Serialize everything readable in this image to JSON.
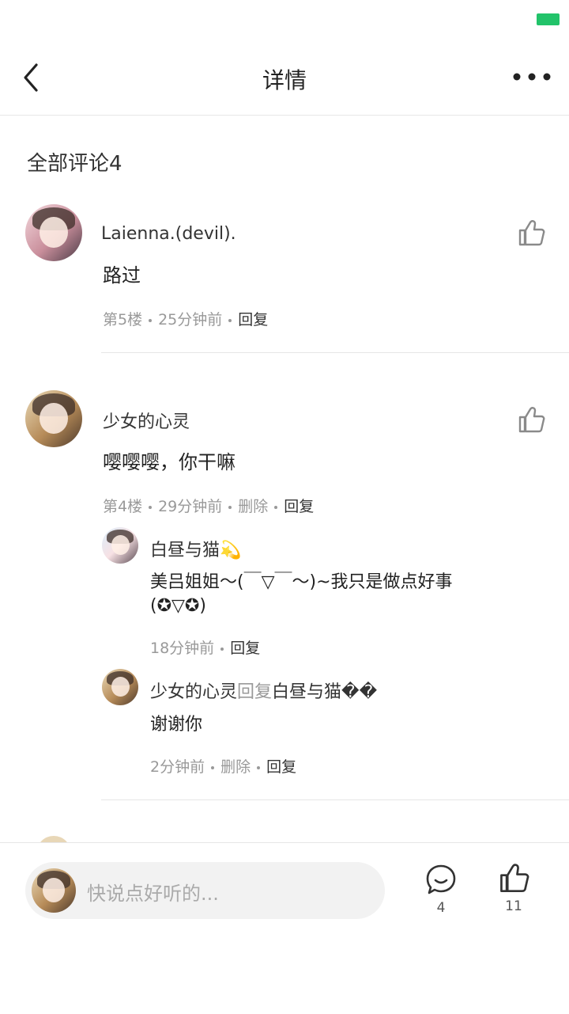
{
  "header": {
    "title": "详情"
  },
  "comments_section": {
    "title": "全部评论4"
  },
  "comments": [
    {
      "author": "Laienna.(devil).",
      "text": "路过",
      "floor": "第5楼",
      "time": "25分钟前",
      "reply_label": "回复"
    },
    {
      "author": "少女的心灵",
      "text": "嘤嘤嘤，你干嘛",
      "floor": "第4楼",
      "time": "29分钟前",
      "delete_label": "删除",
      "reply_label": "回复",
      "replies": [
        {
          "author": "白昼与猫💫",
          "text": "美吕姐姐～(￣▽￣～)~我只是做点好事(✪▽✪)",
          "time": "18分钟前",
          "reply_label": "回复"
        },
        {
          "author": "少女的心灵",
          "reply_word": "回复",
          "target": "白昼与猫��",
          "text": "谢谢你",
          "time": "2分钟前",
          "delete_label": "删除",
          "reply_label": "回复"
        }
      ]
    }
  ],
  "input_bar": {
    "placeholder": "快说点好听的...",
    "comment_count": "4",
    "like_count": "11"
  },
  "colors": {
    "battery": "#22c36a",
    "muted": "#999999",
    "divider": "#e6e6e6"
  }
}
